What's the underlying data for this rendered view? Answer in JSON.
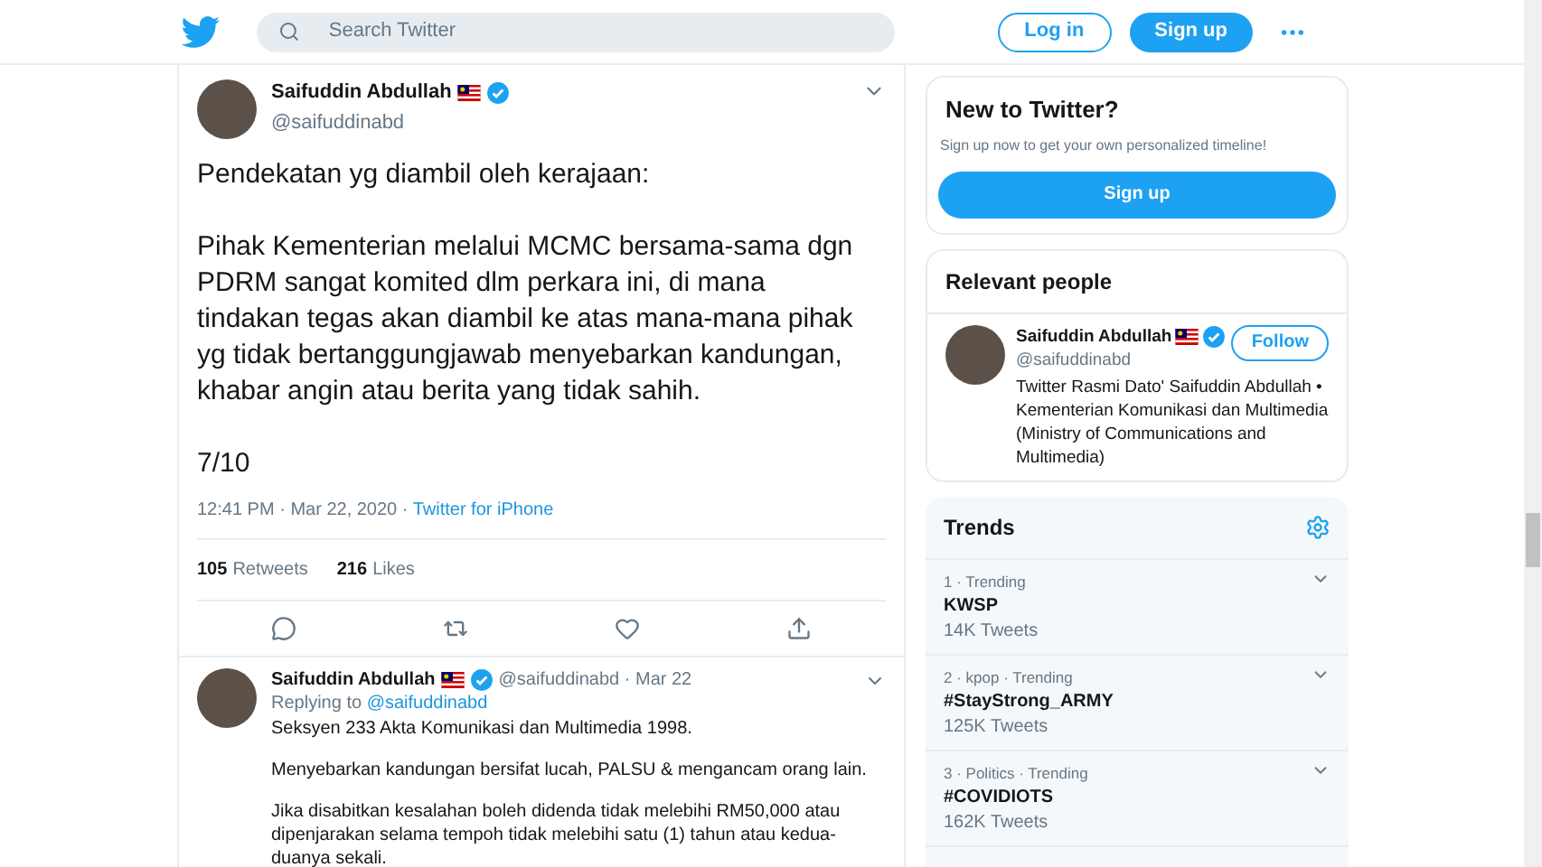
{
  "header": {
    "search_placeholder": "Search Twitter",
    "login": "Log in",
    "signup": "Sign up"
  },
  "tweet": {
    "name": "Saifuddin Abdullah",
    "handle": "@saifuddinabd",
    "verified": true,
    "paragraphs": [
      "Pendekatan yg diambil oleh kerajaan:",
      "Pihak Kementerian melalui MCMC bersama-sama dgn PDRM sangat komited dlm perkara ini, di mana tindakan tegas akan diambil ke atas mana-mana pihak yg tidak bertanggungjawab menyebarkan kandungan, khabar angin atau berita yang tidak sahih.",
      "7/10"
    ],
    "time": "12:41 PM · Mar 22, 2020 · ",
    "source": "Twitter for iPhone",
    "stats": [
      {
        "count": "105",
        "label": "Retweets"
      },
      {
        "count": "216",
        "label": "Likes"
      }
    ]
  },
  "reply": {
    "name": "Saifuddin Abdullah",
    "verified": true,
    "handle_date": "@saifuddinabd · Mar 22",
    "replying_to": "Replying to ",
    "replying_handle": "@saifuddinabd",
    "paragraphs": [
      "Seksyen 233 Akta Komunikasi dan Multimedia 1998.",
      "Menyebarkan kandungan bersifat lucah, PALSU & mengancam orang lain.",
      "Jika disabitkan kesalahan boleh didenda tidak melebihi RM50,000 atau dipenjarakan selama tempoh tidak melebihi satu (1) tahun atau kedua-duanya sekali."
    ]
  },
  "new_to_twitter": {
    "title": "New to Twitter?",
    "text": "Sign up now to get your own personalized timeline!",
    "button": "Sign up"
  },
  "relevant_people": {
    "title": "Relevant people",
    "name": "Saifuddin Abdullah",
    "verified": true,
    "handle": "@saifuddinabd",
    "follow": "Follow",
    "bio": "Twitter Rasmi Dato' Saifuddin Abdullah • Kementerian Komunikasi dan Multimedia (Ministry of Communications and Multimedia)"
  },
  "trends": {
    "title": "Trends",
    "items": [
      {
        "context": "1 · Trending",
        "name": "KWSP",
        "count": "14K Tweets"
      },
      {
        "context": "2 · kpop · Trending",
        "name": "#StayStrong_ARMY",
        "count": "125K Tweets"
      },
      {
        "context": "3 · Politics · Trending",
        "name": "#COVIDIOTS",
        "count": "162K Tweets"
      }
    ]
  }
}
